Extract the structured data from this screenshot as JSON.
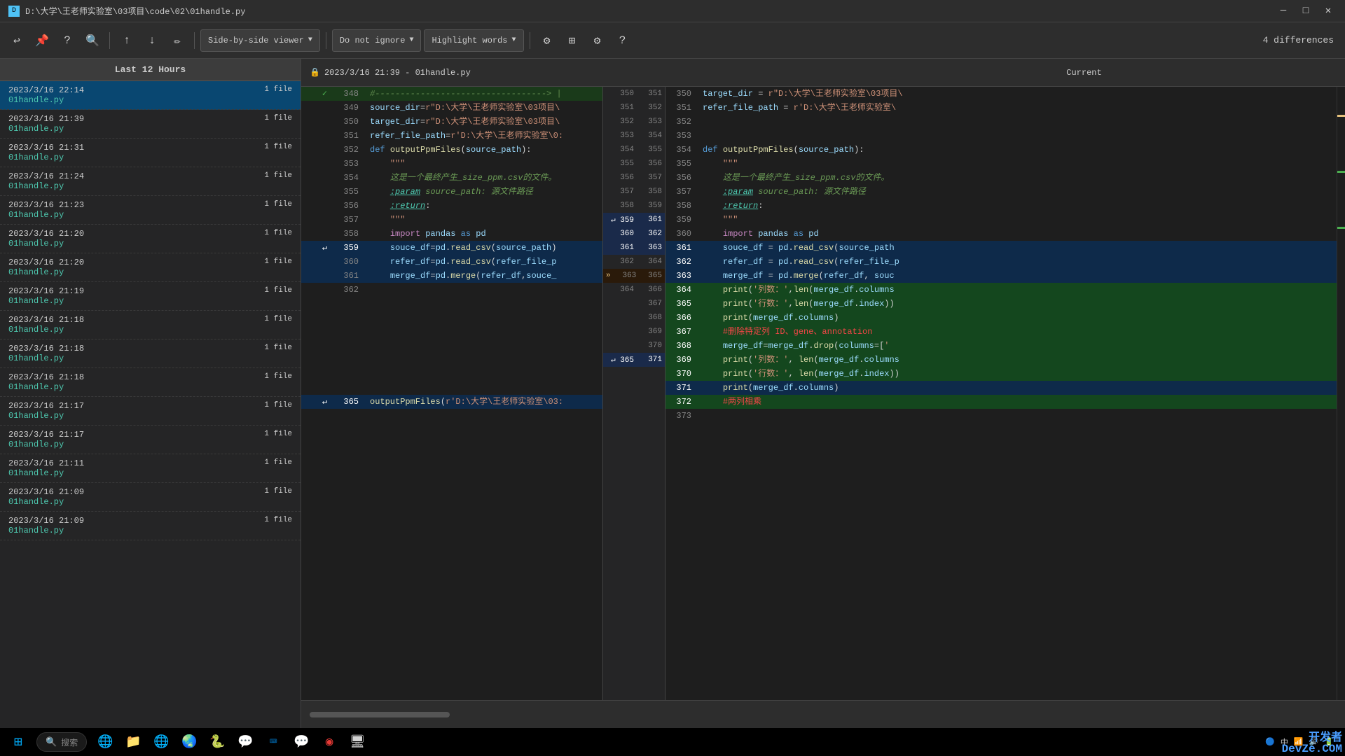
{
  "titleBar": {
    "icon": "D",
    "title": "D:\\大学\\王老师实验室\\03项目\\code\\02\\01handle.py",
    "controls": [
      "minimize",
      "maximize",
      "close"
    ]
  },
  "toolbar": {
    "buttons": [
      "undo",
      "pin",
      "help",
      "search",
      "redo"
    ],
    "nav": [
      "prev-diff",
      "next-diff"
    ],
    "edit": "edit",
    "viewerLabel": "Side-by-side viewer",
    "ignoreLabel": "Do not ignore",
    "highlightLabel": "Highlight words",
    "settings": [
      "options",
      "layout",
      "gear",
      "help"
    ],
    "diffCount": "4 differences"
  },
  "sidebar": {
    "header": "Last 12 Hours",
    "items": [
      {
        "date": "2023/3/16 22:14",
        "filename": "01handle.py",
        "count": "1 file",
        "active": true
      },
      {
        "date": "2023/3/16 21:39",
        "filename": "01handle.py",
        "count": "1 file",
        "active": false
      },
      {
        "date": "2023/3/16 21:31",
        "filename": "01handle.py",
        "count": "1 file",
        "active": false
      },
      {
        "date": "2023/3/16 21:24",
        "filename": "01handle.py",
        "count": "1 file",
        "active": false
      },
      {
        "date": "2023/3/16 21:23",
        "filename": "01handle.py",
        "count": "1 file",
        "active": false
      },
      {
        "date": "2023/3/16 21:20",
        "filename": "01handle.py",
        "count": "1 file",
        "active": false
      },
      {
        "date": "2023/3/16 21:20",
        "filename": "01handle.py",
        "count": "1 file",
        "active": false
      },
      {
        "date": "2023/3/16 21:19",
        "filename": "01handle.py",
        "count": "1 file",
        "active": false
      },
      {
        "date": "2023/3/16 21:18",
        "filename": "01handle.py",
        "count": "1 file",
        "active": false
      },
      {
        "date": "2023/3/16 21:18",
        "filename": "01handle.py",
        "count": "1 file",
        "active": false
      },
      {
        "date": "2023/3/16 21:18",
        "filename": "01handle.py",
        "count": "1 file",
        "active": false
      },
      {
        "date": "2023/3/16 21:17",
        "filename": "01handle.py",
        "count": "1 file",
        "active": false
      },
      {
        "date": "2023/3/16 21:17",
        "filename": "01handle.py",
        "count": "1 file",
        "active": false
      },
      {
        "date": "2023/3/16 21:11",
        "filename": "01handle.py",
        "count": "1 file",
        "active": false
      },
      {
        "date": "2023/3/16 21:09",
        "filename": "01handle.py",
        "count": "1 file",
        "active": false
      },
      {
        "date": "2023/3/16 21:09",
        "filename": "01handle.py",
        "count": "1 file",
        "active": false
      }
    ]
  },
  "panelHeader": {
    "leftLabel": "2023/3/16 21:39 - 01handle.py",
    "rightLabel": "Current"
  },
  "taskbar": {
    "searchPlaceholder": "搜索",
    "trayItems": [
      "中",
      "网络",
      "音量",
      "电源"
    ],
    "time": ""
  },
  "watermark": "开发者\nDevZe.COM"
}
